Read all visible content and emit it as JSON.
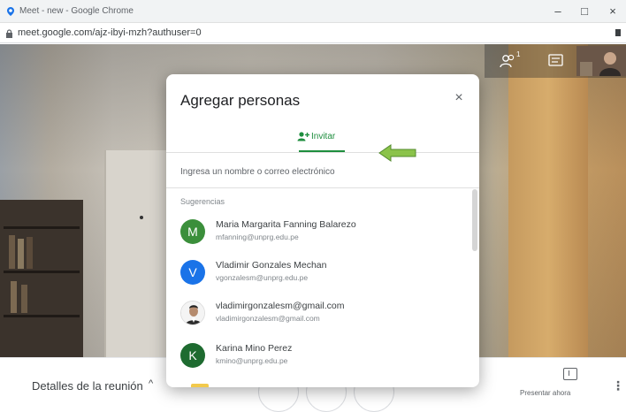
{
  "browser": {
    "title": "Meet - new - Google Chrome",
    "url": "meet.google.com/ajz-ibyi-mzh?authuser=0",
    "minimize_label": "–",
    "maximize_label": "□",
    "close_label": "×"
  },
  "controls": {
    "people_count": "1"
  },
  "dialog": {
    "title": "Agregar personas",
    "close_label": "×",
    "tab_label": "Invitar",
    "search_placeholder": "Ingresa un nombre o correo electrónico",
    "suggestions_header": "Sugerencias",
    "suggestions": [
      {
        "initial": "M",
        "name": "Maria Margarita Fanning Balarezo",
        "email": "mfanning@unprg.edu.pe",
        "color": "#3b8f3b"
      },
      {
        "initial": "V",
        "name": "Vladimir Gonzales Mechan",
        "email": "vgonzalesm@unprg.edu.pe",
        "color": "#1a73e8"
      },
      {
        "initial": "",
        "name": "vladimirgonzalesm@gmail.com",
        "email": "vladimirgonzalesm@gmail.com",
        "color": "#ffffff",
        "photo": true
      },
      {
        "initial": "K",
        "name": "Karina Mino Perez",
        "email": "kmino@unprg.edu.pe",
        "color": "#1e6b30"
      }
    ]
  },
  "bottombar": {
    "details_label": "Detalles de la reunión",
    "chevron": "^",
    "present_label": "Presentar ahora",
    "more_label": "⋮"
  },
  "colors": {
    "accent_green": "#1e8e3e",
    "annotation_arrow": "#8bc34a"
  }
}
